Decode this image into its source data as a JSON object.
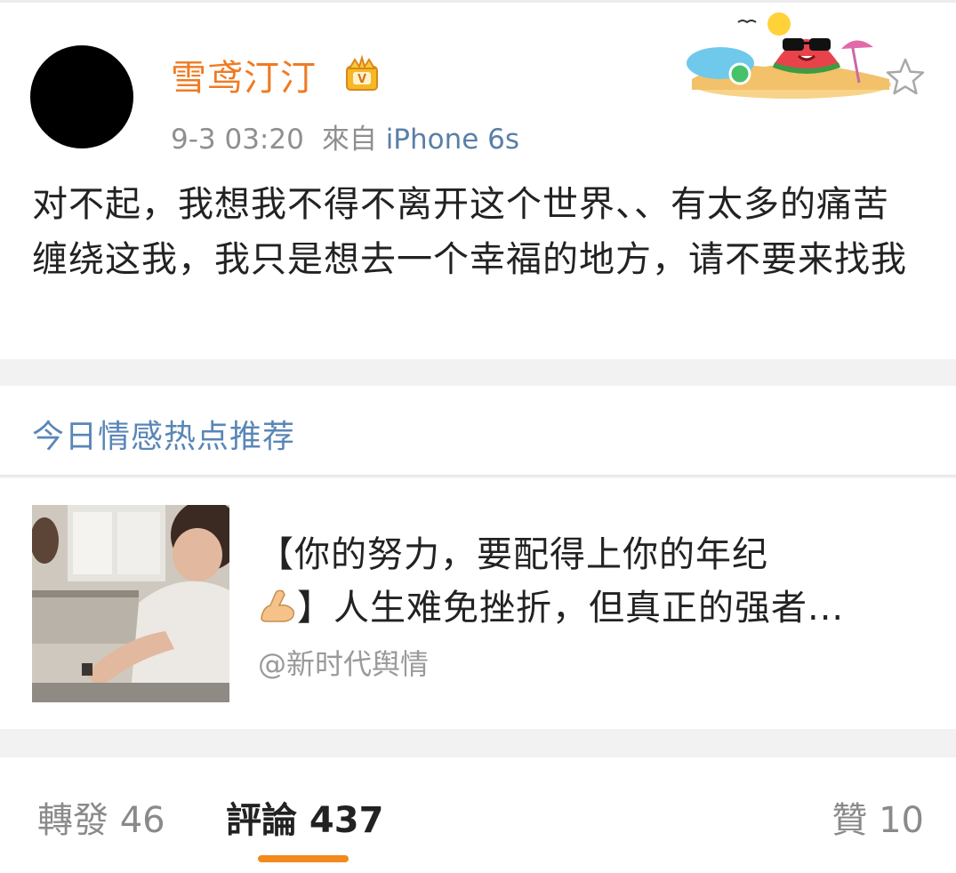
{
  "post": {
    "username": "雪鸢汀汀",
    "time": "9-3 03:20",
    "from_label": "來自",
    "source": "iPhone 6s",
    "text": "对不起，我想我不得不离开这个世界、、有太多的痛苦缠绕这我，我只是想去一个幸福的地方，请不要来找我",
    "icons": {
      "crown": "crown-icon",
      "sticker": "watermelon-sticker",
      "favorite": "star-icon"
    }
  },
  "recommend": {
    "section_title": "今日情感热点推荐",
    "title_line1": "【你的努力，要配得上你的年纪",
    "title_line2": "】人生难免挫折，但真正的强者...",
    "emoji": "flexed-biceps",
    "author": "@新时代舆情"
  },
  "tabs": {
    "repost": "轉發 46",
    "comment": "評論 437",
    "like": "贊 10",
    "active": "comment",
    "accent": "#f28a1e"
  },
  "colors": {
    "username": "#f07a22",
    "link": "#5a7fa8",
    "section_title": "#5a86b8"
  }
}
